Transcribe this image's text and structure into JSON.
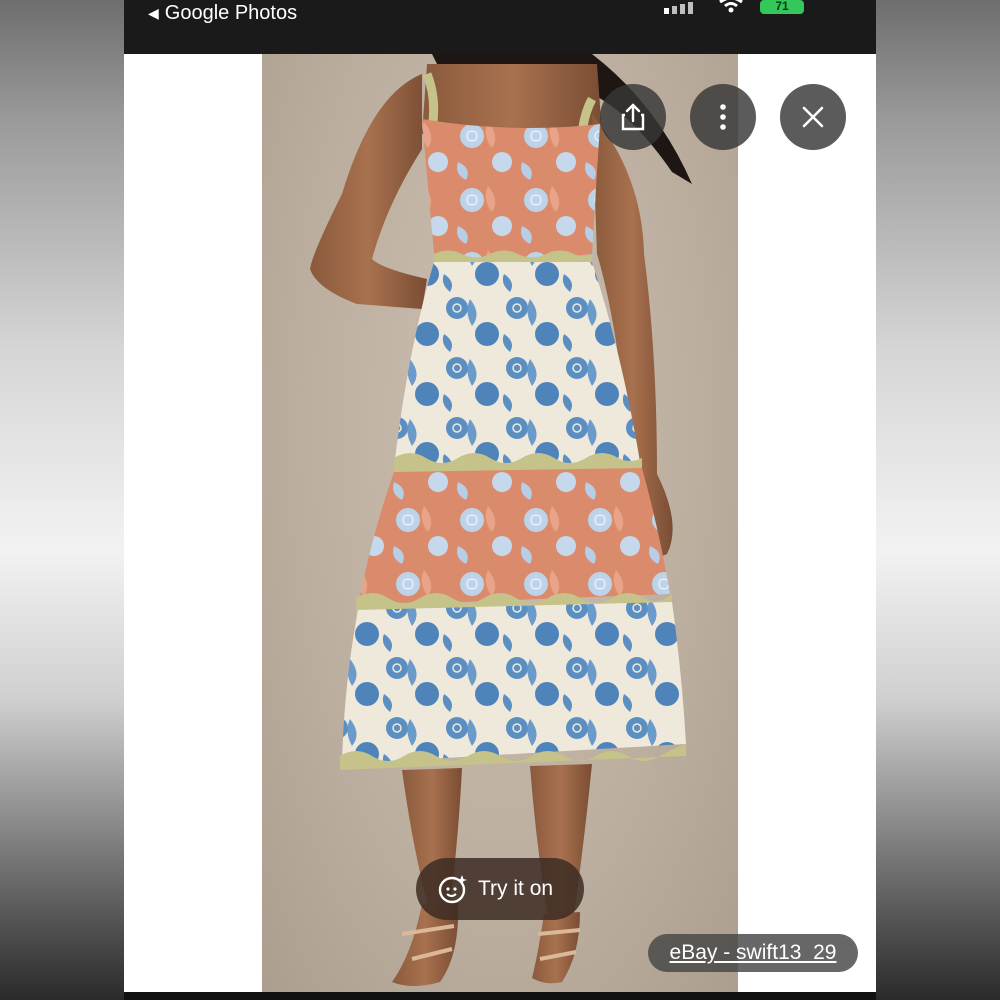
{
  "status_bar": {
    "back_label": "Google Photos",
    "battery": "71"
  },
  "photo": {
    "subject": "model wearing tiered floral midi dress"
  },
  "overlay": {
    "try_on_label": "Try it on",
    "watermark": "eBay - swift13_29"
  },
  "colors": {
    "dress_coral": "#d98b6c",
    "dress_blue": "#5b8fc2",
    "dress_cream": "#efe9dc",
    "trim_green": "#c5c38a"
  },
  "icons": [
    "share-icon",
    "more-vert-icon",
    "close-icon",
    "sparkle-face-icon",
    "back-triangle-icon",
    "wifi-icon"
  ]
}
